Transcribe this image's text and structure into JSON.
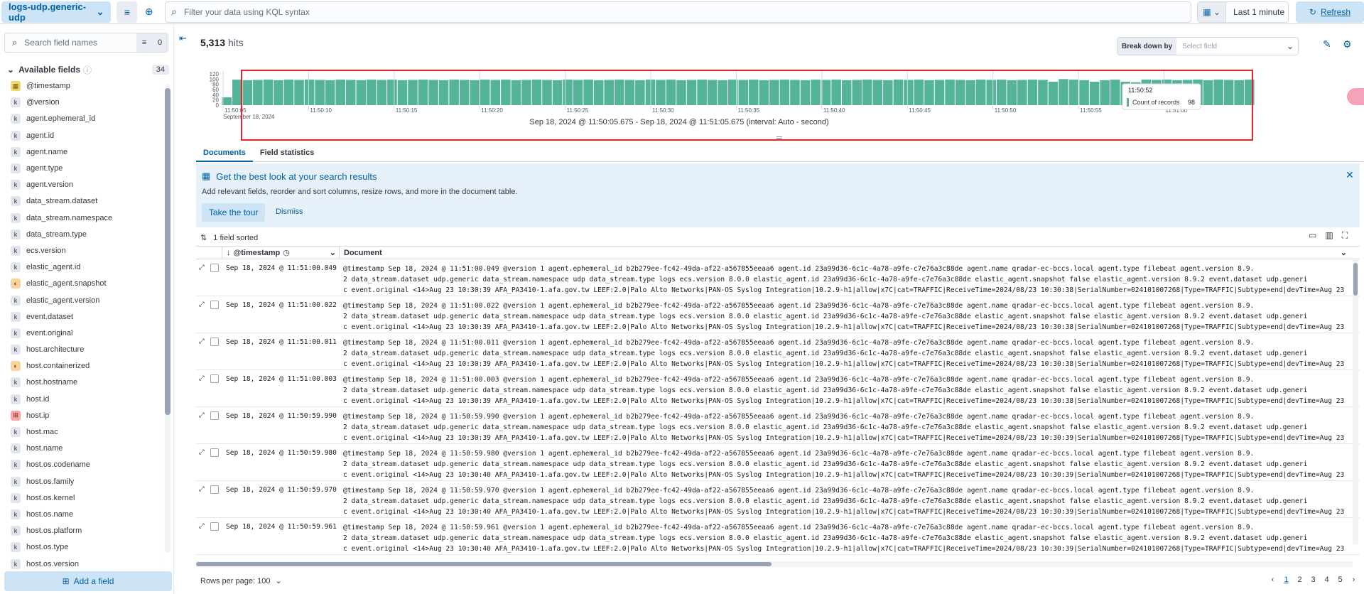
{
  "topbar": {
    "data_view": "logs-udp.generic-udp",
    "kql_placeholder": "Filter your data using KQL syntax",
    "date_quick": "Last 1 minute",
    "refresh_label": "Refresh"
  },
  "sidebar": {
    "search_placeholder": "Search field names",
    "filter_count": "0",
    "available_label": "Available fields",
    "available_count": "34",
    "add_field_label": "Add a field",
    "fields": [
      {
        "name": "@timestamp",
        "type": "d"
      },
      {
        "name": "@version",
        "type": "k"
      },
      {
        "name": "agent.ephemeral_id",
        "type": "k"
      },
      {
        "name": "agent.id",
        "type": "k"
      },
      {
        "name": "agent.name",
        "type": "k"
      },
      {
        "name": "agent.type",
        "type": "k"
      },
      {
        "name": "agent.version",
        "type": "k"
      },
      {
        "name": "data_stream.dataset",
        "type": "k"
      },
      {
        "name": "data_stream.namespace",
        "type": "k"
      },
      {
        "name": "data_stream.type",
        "type": "k"
      },
      {
        "name": "ecs.version",
        "type": "k"
      },
      {
        "name": "elastic_agent.id",
        "type": "k"
      },
      {
        "name": "elastic_agent.snapshot",
        "type": "b"
      },
      {
        "name": "elastic_agent.version",
        "type": "k"
      },
      {
        "name": "event.dataset",
        "type": "k"
      },
      {
        "name": "event.original",
        "type": "k"
      },
      {
        "name": "host.architecture",
        "type": "k"
      },
      {
        "name": "host.containerized",
        "type": "b"
      },
      {
        "name": "host.hostname",
        "type": "k"
      },
      {
        "name": "host.id",
        "type": "k"
      },
      {
        "name": "host.ip",
        "type": "i"
      },
      {
        "name": "host.mac",
        "type": "k"
      },
      {
        "name": "host.name",
        "type": "k"
      },
      {
        "name": "host.os.codename",
        "type": "k"
      },
      {
        "name": "host.os.family",
        "type": "k"
      },
      {
        "name": "host.os.kernel",
        "type": "k"
      },
      {
        "name": "host.os.name",
        "type": "k"
      },
      {
        "name": "host.os.platform",
        "type": "k"
      },
      {
        "name": "host.os.type",
        "type": "k"
      },
      {
        "name": "host.os.version",
        "type": "k"
      }
    ]
  },
  "histogram": {
    "hits": "5,313",
    "hits_unit": "hits",
    "breakdown_label": "Break down by",
    "breakdown_placeholder": "Select field",
    "range_text": "Sep 18, 2024 @ 11:50:05.675 - Sep 18, 2024 @ 11:51:05.675 (interval: Auto - second)",
    "y_ticks": [
      "120",
      "100",
      "80",
      "60",
      "40",
      "20",
      "0"
    ],
    "x_ticks": [
      "11:50:05",
      "11:50:10",
      "11:50:15",
      "11:50:20",
      "11:50:25",
      "11:50:30",
      "11:50:35",
      "11:50:40",
      "11:50:45",
      "11:50:50",
      "11:50:55",
      "11:51:00"
    ],
    "x_sublabel": "September 18, 2024",
    "tooltip_time": "11:50:52",
    "tooltip_label": "Count of records",
    "tooltip_value": "98",
    "bar_color": "#54b399"
  },
  "chart_data": {
    "type": "bar",
    "title": "",
    "xlabel": "",
    "ylabel": "",
    "ylim": [
      0,
      120
    ],
    "values": [
      30,
      98,
      96,
      97,
      98,
      96,
      98,
      97,
      98,
      97,
      96,
      98,
      97,
      96,
      98,
      97,
      98,
      96,
      97,
      98,
      97,
      96,
      98,
      97,
      96,
      98,
      97,
      98,
      96,
      97,
      98,
      97,
      96,
      98,
      97,
      98,
      96,
      97,
      98,
      97,
      96,
      98,
      97,
      98,
      96,
      97,
      98,
      97,
      96,
      98,
      97,
      98,
      96,
      97,
      98,
      97,
      96,
      98,
      97,
      98,
      96,
      97,
      98,
      97,
      96,
      98,
      97,
      98,
      96,
      97,
      98,
      97,
      96,
      98,
      97,
      98,
      96,
      97,
      98,
      97,
      90,
      100,
      98,
      96,
      90,
      96,
      98,
      90,
      88,
      98,
      97,
      98,
      96,
      97,
      98,
      96,
      98,
      97,
      96,
      98
    ]
  },
  "tabs": [
    "Documents",
    "Field statistics"
  ],
  "callout": {
    "title": "Get the best look at your search results",
    "desc": "Add relevant fields, reorder and sort columns, resize rows, and more in the document table.",
    "tour": "Take the tour",
    "dismiss": "Dismiss"
  },
  "grid": {
    "sort_info": "1 field sorted",
    "col_timestamp": "@timestamp",
    "col_document": "Document",
    "rows": [
      {
        "ts": "Sep 18, 2024 @ 11:51:00.049",
        "l1": "@timestamp Sep 18, 2024 @ 11:51:00.049 @version 1 agent.ephemeral_id b2b279ee-fc42-49da-af22-a567855eeaa6 agent.id 23a99d36-6c1c-4a78-a9fe-c7e76a3c88de agent.name qradar-ec-bccs.local agent.type filebeat agent.version 8.9.",
        "l2": "2 data_stream.dataset udp.generic data_stream.namespace udp data_stream.type logs ecs.version 8.0.0 elastic_agent.id 23a99d36-6c1c-4a78-a9fe-c7e76a3c88de elastic_agent.snapshot false elastic_agent.version 8.9.2 event.dataset udp.generi",
        "l3": "c event.original <14>Aug 23 10:30:39 AFA_PA3410-1.afa.gov.tw LEEF:2.0|Palo Alto Networks|PAN-OS Syslog Integration|10.2.9-h1|allow|x7C|cat=TRAFFIC|ReceiveTime=2024/08/23 10:30:38|SerialNumber=024101007268|Type=TRAFFIC|Subtype=end|devTime=Aug 23"
      },
      {
        "ts": "Sep 18, 2024 @ 11:51:00.022",
        "l1": "@timestamp Sep 18, 2024 @ 11:51:00.022 @version 1 agent.ephemeral_id b2b279ee-fc42-49da-af22-a567855eeaa6 agent.id 23a99d36-6c1c-4a78-a9fe-c7e76a3c88de agent.name qradar-ec-bccs.local agent.type filebeat agent.version 8.9.",
        "l2": "2 data_stream.dataset udp.generic data_stream.namespace udp data_stream.type logs ecs.version 8.0.0 elastic_agent.id 23a99d36-6c1c-4a78-a9fe-c7e76a3c88de elastic_agent.snapshot false elastic_agent.version 8.9.2 event.dataset udp.generi",
        "l3": "c event.original <14>Aug 23 10:30:39 AFA_PA3410-1.afa.gov.tw LEEF:2.0|Palo Alto Networks|PAN-OS Syslog Integration|10.2.9-h1|allow|x7C|cat=TRAFFIC|ReceiveTime=2024/08/23 10:30:38|SerialNumber=024101007268|Type=TRAFFIC|Subtype=end|devTime=Aug 23"
      },
      {
        "ts": "Sep 18, 2024 @ 11:51:00.011",
        "l1": "@timestamp Sep 18, 2024 @ 11:51:00.011 @version 1 agent.ephemeral_id b2b279ee-fc42-49da-af22-a567855eeaa6 agent.id 23a99d36-6c1c-4a78-a9fe-c7e76a3c88de agent.name qradar-ec-bccs.local agent.type filebeat agent.version 8.9.",
        "l2": "2 data_stream.dataset udp.generic data_stream.namespace udp data_stream.type logs ecs.version 8.0.0 elastic_agent.id 23a99d36-6c1c-4a78-a9fe-c7e76a3c88de elastic_agent.snapshot false elastic_agent.version 8.9.2 event.dataset udp.generi",
        "l3": "c event.original <14>Aug 23 10:30:39 AFA_PA3410-1.afa.gov.tw LEEF:2.0|Palo Alto Networks|PAN-OS Syslog Integration|10.2.9-h1|allow|x7C|cat=TRAFFIC|ReceiveTime=2024/08/23 10:30:38|SerialNumber=024101007268|Type=TRAFFIC|Subtype=end|devTime=Aug 23"
      },
      {
        "ts": "Sep 18, 2024 @ 11:51:00.003",
        "l1": "@timestamp Sep 18, 2024 @ 11:51:00.003 @version 1 agent.ephemeral_id b2b279ee-fc42-49da-af22-a567855eeaa6 agent.id 23a99d36-6c1c-4a78-a9fe-c7e76a3c88de agent.name qradar-ec-bccs.local agent.type filebeat agent.version 8.9.",
        "l2": "2 data_stream.dataset udp.generic data_stream.namespace udp data_stream.type logs ecs.version 8.0.0 elastic_agent.id 23a99d36-6c1c-4a78-a9fe-c7e76a3c88de elastic_agent.snapshot false elastic_agent.version 8.9.2 event.dataset udp.generi",
        "l3": "c event.original <14>Aug 23 10:30:39 AFA_PA3410-1.afa.gov.tw LEEF:2.0|Palo Alto Networks|PAN-OS Syslog Integration|10.2.9-h1|allow|x7C|cat=TRAFFIC|ReceiveTime=2024/08/23 10:30:38|SerialNumber=024101007268|Type=TRAFFIC|Subtype=end|devTime=Aug 23"
      },
      {
        "ts": "Sep 18, 2024 @ 11:50:59.990",
        "l1": "@timestamp Sep 18, 2024 @ 11:50:59.990 @version 1 agent.ephemeral_id b2b279ee-fc42-49da-af22-a567855eeaa6 agent.id 23a99d36-6c1c-4a78-a9fe-c7e76a3c88de agent.name qradar-ec-bccs.local agent.type filebeat agent.version 8.9.",
        "l2": "2 data_stream.dataset udp.generic data_stream.namespace udp data_stream.type logs ecs.version 8.0.0 elastic_agent.id 23a99d36-6c1c-4a78-a9fe-c7e76a3c88de elastic_agent.snapshot false elastic_agent.version 8.9.2 event.dataset udp.generi",
        "l3": "c event.original <14>Aug 23 10:30:39 AFA_PA3410-1.afa.gov.tw LEEF:2.0|Palo Alto Networks|PAN-OS Syslog Integration|10.2.9-h1|allow|x7C|cat=TRAFFIC|ReceiveTime=2024/08/23 10:30:39|SerialNumber=024101007268|Type=TRAFFIC|Subtype=end|devTime=Aug 23"
      },
      {
        "ts": "Sep 18, 2024 @ 11:50:59.980",
        "l1": "@timestamp Sep 18, 2024 @ 11:50:59.980 @version 1 agent.ephemeral_id b2b279ee-fc42-49da-af22-a567855eeaa6 agent.id 23a99d36-6c1c-4a78-a9fe-c7e76a3c88de agent.name qradar-ec-bccs.local agent.type filebeat agent.version 8.9.",
        "l2": "2 data_stream.dataset udp.generic data_stream.namespace udp data_stream.type logs ecs.version 8.0.0 elastic_agent.id 23a99d36-6c1c-4a78-a9fe-c7e76a3c88de elastic_agent.snapshot false elastic_agent.version 8.9.2 event.dataset udp.generi",
        "l3": "c event.original <14>Aug 23 10:30:40 AFA_PA3410-1.afa.gov.tw LEEF:2.0|Palo Alto Networks|PAN-OS Syslog Integration|10.2.9-h1|allow|x7C|cat=TRAFFIC|ReceiveTime=2024/08/23 10:30:39|SerialNumber=024101007268|Type=TRAFFIC|Subtype=end|devTime=Aug 23"
      },
      {
        "ts": "Sep 18, 2024 @ 11:50:59.970",
        "l1": "@timestamp Sep 18, 2024 @ 11:50:59.970 @version 1 agent.ephemeral_id b2b279ee-fc42-49da-af22-a567855eeaa6 agent.id 23a99d36-6c1c-4a78-a9fe-c7e76a3c88de agent.name qradar-ec-bccs.local agent.type filebeat agent.version 8.9.",
        "l2": "2 data_stream.dataset udp.generic data_stream.namespace udp data_stream.type logs ecs.version 8.0.0 elastic_agent.id 23a99d36-6c1c-4a78-a9fe-c7e76a3c88de elastic_agent.snapshot false elastic_agent.version 8.9.2 event.dataset udp.generi",
        "l3": "c event.original <14>Aug 23 10:30:40 AFA_PA3410-1.afa.gov.tw LEEF:2.0|Palo Alto Networks|PAN-OS Syslog Integration|10.2.9-h1|allow|x7C|cat=TRAFFIC|ReceiveTime=2024/08/23 10:30:39|SerialNumber=024101007268|Type=TRAFFIC|Subtype=end|devTime=Aug 23"
      },
      {
        "ts": "Sep 18, 2024 @ 11:50:59.961",
        "l1": "@timestamp Sep 18, 2024 @ 11:50:59.961 @version 1 agent.ephemeral_id b2b279ee-fc42-49da-af22-a567855eeaa6 agent.id 23a99d36-6c1c-4a78-a9fe-c7e76a3c88de agent.name qradar-ec-bccs.local agent.type filebeat agent.version 8.9.",
        "l2": "2 data_stream.dataset udp.generic data_stream.namespace udp data_stream.type logs ecs.version 8.0.0 elastic_agent.id 23a99d36-6c1c-4a78-a9fe-c7e76a3c88de elastic_agent.snapshot false elastic_agent.version 8.9.2 event.dataset udp.generi",
        "l3": "c event.original <14>Aug 23 10:30:40 AFA_PA3410-1.afa.gov.tw LEEF:2.0|Palo Alto Networks|PAN-OS Syslog Integration|10.2.9-h1|allow|x7C|cat=TRAFFIC|ReceiveTime=2024/08/23 10:30:39|SerialNumber=024101007268|Type=TRAFFIC|Subtype=end|devTime=Aug 23"
      }
    ]
  },
  "footer": {
    "rows_per_page": "Rows per page: 100",
    "pages": [
      "1",
      "2",
      "3",
      "4",
      "5"
    ]
  }
}
